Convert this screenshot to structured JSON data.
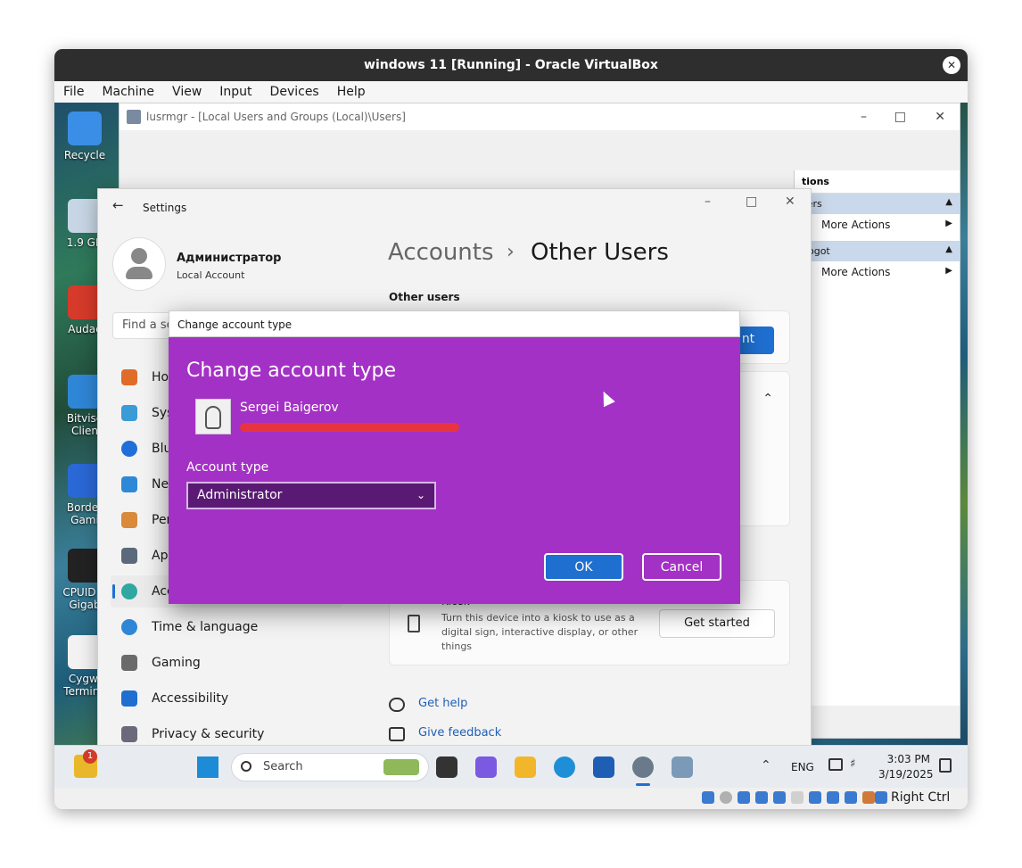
{
  "vbox": {
    "title": "windows 11 [Running] - Oracle VirtualBox",
    "close_label": "✕",
    "menu": [
      "File",
      "Machine",
      "View",
      "Input",
      "Devices",
      "Help"
    ],
    "host_key": "Right Ctrl"
  },
  "desktop": {
    "icons": [
      {
        "label": "Recycle",
        "color": "#3a8ee6"
      },
      {
        "label": "1.9 GB",
        "color": "#c7d6e4"
      },
      {
        "label": "Audac",
        "color": "#d53a2a"
      },
      {
        "label": "Bitvise Clien",
        "color": "#2f86d6"
      },
      {
        "label": "Border Gami",
        "color": "#2a68d6"
      },
      {
        "label": "CPUID C Gigab",
        "color": "#222222"
      },
      {
        "label": "Cygwi Termina",
        "color": "#f2f2f2"
      }
    ]
  },
  "lusrmgr": {
    "title": "lusrmgr - [Local Users and Groups (Local)\\Users]",
    "actions_header": "tions",
    "section1": "sers",
    "section2": "gogot",
    "more_actions_1": "More Actions",
    "more_actions_2": "More Actions"
  },
  "settings": {
    "back_label": "←",
    "title": "Settings",
    "user_name": "Администратор",
    "user_type": "Local Account",
    "search_placeholder": "Find a se",
    "nav": [
      {
        "label": "Ho",
        "color": "#e06c2a"
      },
      {
        "label": "Sys",
        "color": "#3a9bd6"
      },
      {
        "label": "Blu",
        "color": "#1e6fd9"
      },
      {
        "label": "Ne",
        "color": "#2e88d8"
      },
      {
        "label": "Per",
        "color": "#d98a3a"
      },
      {
        "label": "App",
        "color": "#5a6a7a"
      },
      {
        "label": "Acc",
        "color": "#2ea8a0"
      },
      {
        "label": "Time & language",
        "color": "#2f86d6"
      },
      {
        "label": "Gaming",
        "color": "#6a6a6a"
      },
      {
        "label": "Accessibility",
        "color": "#1f6fd0"
      },
      {
        "label": "Privacy & security",
        "color": "#6a6a7a"
      }
    ],
    "breadcrumb_parent": "Accounts",
    "breadcrumb_sep": "›",
    "breadcrumb_current": "Other Users",
    "section_title": "Other users",
    "add_account_fragment": "nt",
    "kiosk_title": "Kiosk",
    "kiosk_desc": "Turn this device into a kiosk to use as a digital sign, interactive display, or other things",
    "get_started": "Get started",
    "get_help": "Get help",
    "give_feedback": "Give feedback"
  },
  "dialog": {
    "titlebar": "Change account type",
    "heading": "Change account type",
    "user_name": "Sergei Baigerov",
    "account_type_label": "Account type",
    "account_type_value": "Administrator",
    "ok": "OK",
    "cancel": "Cancel",
    "bg_color": "#a431c5"
  },
  "taskbar": {
    "search_placeholder": "Search",
    "lang": "ENG",
    "time": "3:03 PM",
    "date": "3/19/2025",
    "notification_badge": "1"
  }
}
